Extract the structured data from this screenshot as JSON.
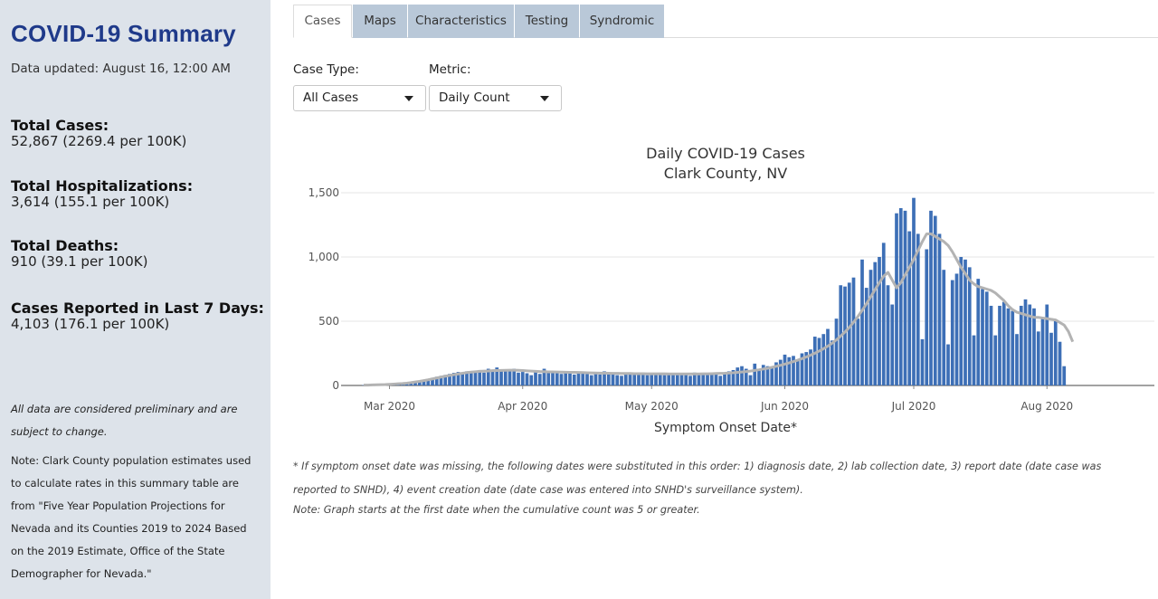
{
  "sidebar": {
    "title": "COVID-19 Summary",
    "updated": "Data updated: August 16, 12:00 AM",
    "stats": [
      {
        "label": "Total Cases:",
        "value": "52,867 (2269.4 per 100K)"
      },
      {
        "label": "Total Hospitalizations:",
        "value": "3,614 (155.1 per 100K)"
      },
      {
        "label": "Total Deaths:",
        "value": "910 (39.1 per 100K)"
      },
      {
        "label": "Cases Reported in Last 7 Days:",
        "value": "4,103 (176.1 per 100K)"
      }
    ],
    "note1": "All data are considered preliminary and are subject to change.",
    "note2": "Note: Clark County population estimates used to calculate rates in this summary table are from \"Five Year Population Projections for Nevada and its Counties 2019 to 2024 Based on the 2019 Estimate, Office of the State Demographer for Nevada.\""
  },
  "tabs": [
    "Cases",
    "Maps",
    "Characteristics",
    "Testing",
    "Syndromic"
  ],
  "active_tab": "Cases",
  "controls": {
    "case_type_label": "Case Type:",
    "case_type_value": "All Cases",
    "metric_label": "Metric:",
    "metric_value": "Daily Count"
  },
  "footnotes": {
    "onset": "* If symptom onset date was missing, the following dates were substituted in this order: 1) diagnosis date, 2) lab collection date, 3) report date (date case was reported to SNHD), 4) event creation date (date case was entered into SNHD's surveillance system).",
    "start": "Note: Graph starts at the first date when the cumulative count was 5 or greater."
  },
  "colors": {
    "bar": "#3d6fb6",
    "rolling_line": "#b3b3b3",
    "tab_inactive": "#b9c8d8",
    "sidebar_bg": "#dde3ea",
    "title": "#1f3a8a"
  },
  "chart_data": {
    "type": "bar",
    "title": "Daily COVID-19 Cases",
    "subtitle": "Clark County, NV",
    "xlabel": "Symptom Onset Date*",
    "ylabel": "",
    "ylim": [
      0,
      1500
    ],
    "yticks": [
      0,
      500,
      1000,
      1500
    ],
    "ytick_labels": [
      "0",
      "500",
      "1,000",
      "1,500"
    ],
    "x_start": "2020-02-24",
    "x_end": "2020-08-15",
    "xticks": [
      {
        "date": "2020-03-01",
        "label": "Mar 2020"
      },
      {
        "date": "2020-04-01",
        "label": "Apr 2020"
      },
      {
        "date": "2020-05-01",
        "label": "May 2020"
      },
      {
        "date": "2020-06-01",
        "label": "Jun 2020"
      },
      {
        "date": "2020-07-01",
        "label": "Jul 2020"
      },
      {
        "date": "2020-08-01",
        "label": "Aug 2020"
      }
    ],
    "grid": true,
    "series": [
      {
        "type": "bar",
        "values": [
          3,
          2,
          4,
          5,
          6,
          8,
          10,
          12,
          15,
          18,
          22,
          28,
          33,
          38,
          45,
          52,
          60,
          68,
          75,
          82,
          90,
          98,
          105,
          100,
          110,
          95,
          105,
          120,
          100,
          130,
          110,
          140,
          115,
          125,
          110,
          130,
          100,
          105,
          95,
          80,
          110,
          90,
          130,
          100,
          110,
          95,
          90,
          95,
          105,
          85,
          100,
          95,
          90,
          80,
          95,
          85,
          110,
          90,
          85,
          80,
          75,
          95,
          85,
          90,
          85,
          100,
          80,
          90,
          85,
          95,
          80,
          90,
          85,
          95,
          85,
          90,
          75,
          100,
          90,
          95,
          85,
          100,
          95,
          75,
          95,
          110,
          120,
          140,
          150,
          130,
          80,
          170,
          130,
          160,
          150,
          140,
          180,
          200,
          240,
          220,
          230,
          200,
          250,
          260,
          280,
          380,
          370,
          400,
          440,
          350,
          520,
          780,
          770,
          800,
          840,
          520,
          980,
          760,
          900,
          960,
          1000,
          1110,
          780,
          630,
          1340,
          1380,
          1360,
          1200,
          1460,
          1180,
          360,
          1060,
          1360,
          1320,
          1180,
          900,
          320,
          820,
          870,
          1000,
          980,
          920,
          390,
          830,
          750,
          730,
          620,
          390,
          620,
          650,
          600,
          580,
          400,
          620,
          670,
          630,
          600,
          420,
          520,
          630,
          410,
          500,
          340,
          150
        ]
      },
      {
        "type": "line",
        "values": [
          3,
          3,
          4,
          5,
          6,
          7,
          9,
          11,
          13,
          15,
          18,
          22,
          27,
          32,
          38,
          44,
          51,
          58,
          65,
          72,
          78,
          84,
          90,
          95,
          100,
          104,
          107,
          110,
          112,
          113,
          115,
          116,
          117,
          118,
          119,
          119,
          118,
          116,
          114,
          112,
          110,
          108,
          107,
          106,
          106,
          105,
          104,
          103,
          102,
          102,
          101,
          100,
          99,
          98,
          97,
          96,
          96,
          95,
          94,
          94,
          93,
          93,
          93,
          92,
          92,
          92,
          91,
          91,
          91,
          91,
          91,
          90,
          90,
          90,
          90,
          90,
          90,
          90,
          90,
          91,
          91,
          92,
          93,
          94,
          95,
          97,
          99,
          102,
          105,
          108,
          112,
          117,
          122,
          128,
          134,
          141,
          149,
          157,
          166,
          176,
          186,
          197,
          209,
          222,
          236,
          251,
          268,
          286,
          306,
          329,
          355,
          384,
          416,
          452,
          492,
          536,
          584,
          636,
          690,
          746,
          800,
          850,
          880,
          820,
          760,
          800,
          860,
          920,
          980,
          1050,
          1120,
          1180,
          1180,
          1160,
          1140,
          1120,
          1090,
          1040,
          980,
          920,
          870,
          820,
          790,
          770,
          760,
          750,
          740,
          720,
          690,
          660,
          620,
          590,
          570,
          560,
          550,
          540,
          530,
          530,
          525,
          520,
          515,
          510,
          490,
          470,
          420,
          340
        ]
      }
    ]
  }
}
